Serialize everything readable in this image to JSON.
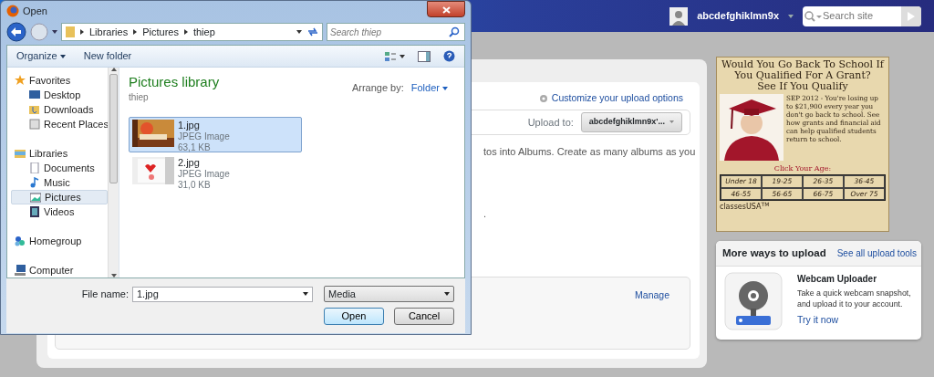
{
  "dialog": {
    "title": "Open",
    "path": [
      "Libraries",
      "Pictures",
      "thiep"
    ],
    "search": {
      "placeholder": "Search thiep"
    },
    "toolbar": [
      "Organize",
      "New folder"
    ],
    "navigation": [
      {
        "label": "Favorites",
        "selected": false,
        "children": [
          {
            "label": "Desktop",
            "selected": false
          },
          {
            "label": "Downloads",
            "selected": false
          },
          {
            "label": "Recent Places",
            "selected": false
          }
        ]
      },
      {
        "label": "Libraries",
        "selected": false,
        "children": [
          {
            "label": "Documents",
            "selected": false
          },
          {
            "label": "Music",
            "selected": false
          },
          {
            "label": "Pictures",
            "selected": true
          },
          {
            "label": "Videos",
            "selected": false
          }
        ]
      },
      {
        "label": "Homegroup",
        "selected": false
      },
      {
        "label": "Computer",
        "selected": false
      }
    ],
    "library": {
      "title": "Pictures library",
      "subtitle": "thiep",
      "arrange_label": "Arrange by:",
      "arrange_value": "Folder"
    },
    "files": [
      {
        "name": "1.jpg",
        "type": "JPEG Image",
        "size": "63,1 KB",
        "selected": true,
        "kind": "picture"
      },
      {
        "name": "2.jpg",
        "type": "JPEG Image",
        "size": "31,0 KB",
        "selected": false,
        "kind": "picture"
      }
    ],
    "file_name": {
      "label": "File name:",
      "value": "1.jpg"
    },
    "file_type": "Media",
    "buttons": [
      "Open",
      "Cancel"
    ]
  },
  "header": {
    "username": "abcdefghiklmn9x",
    "search": {
      "placeholder": "Search site"
    }
  },
  "upload": {
    "customize_link": "Customize your upload options",
    "upload_to_label": "Upload to:",
    "upload_to_value": "abcdefghiklmn9x'...",
    "description": "tos into Albums. Create as many albums as you",
    "fragment": ".",
    "manage_link": "Manage"
  },
  "ad": {
    "headline": "Would You Go Back To School If You Qualified For A Grant?",
    "subheadline": "See If You Qualify",
    "body": "SEP 2012 - You're losing up to $21,900 every year you don't go back to school. See how grants and financial aid can help qualified students return to school.",
    "prompt": "Click Your Age:",
    "ages": [
      "Under 18",
      "19-25",
      "26-35",
      "36-45",
      "46-55",
      "56-65",
      "66-75",
      "Over 75"
    ],
    "brand": "classesUSA$^{TM}$"
  },
  "more_ways": {
    "title": "More ways to upload",
    "link": "See all upload tools",
    "tool_title": "Webcam Uploader",
    "tool_description": "Take a quick webcam snapshot, and upload it to your account.",
    "tool_link": "Try it now"
  }
}
